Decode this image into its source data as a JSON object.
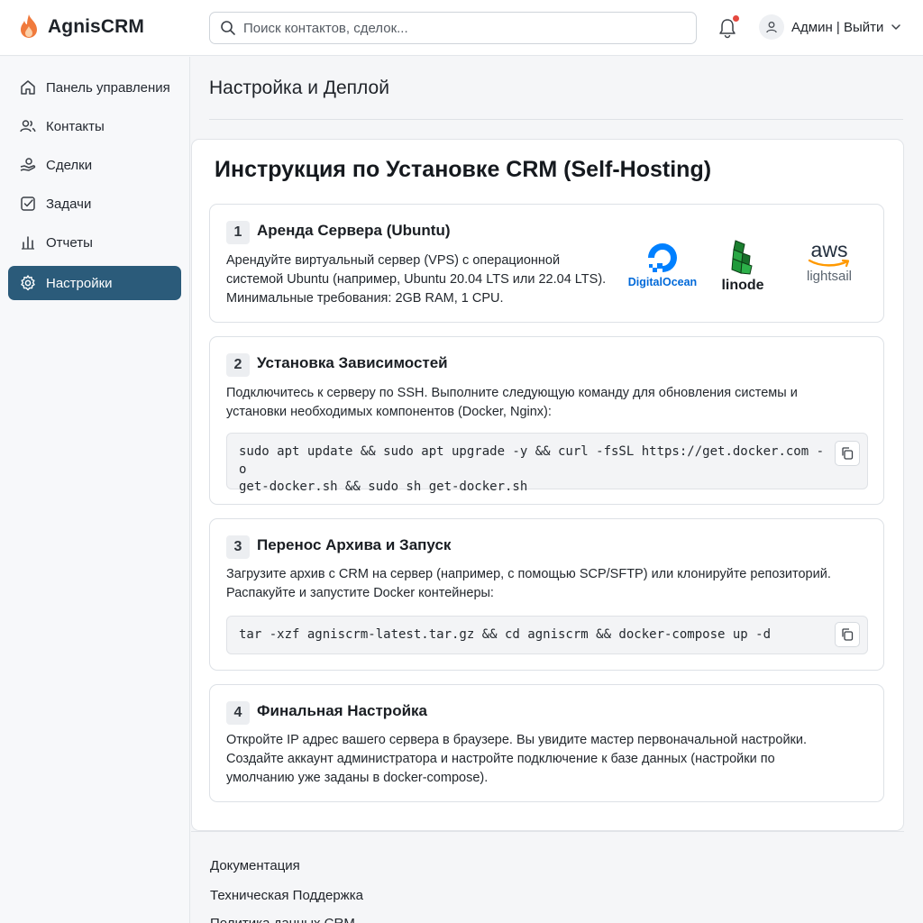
{
  "app": {
    "name": "AgnisCRM"
  },
  "search": {
    "placeholder": "Поиск контактов, сделок..."
  },
  "user": {
    "label": "Админ | Выйти"
  },
  "sidebar": {
    "items": [
      {
        "label": "Панель управления",
        "icon": "home-icon"
      },
      {
        "label": "Контакты",
        "icon": "users-icon"
      },
      {
        "label": "Сделки",
        "icon": "handshake-icon"
      },
      {
        "label": "Задачи",
        "icon": "checkbox-icon"
      },
      {
        "label": "Отчеты",
        "icon": "bar-chart-icon"
      },
      {
        "label": "Настройки",
        "icon": "gear-icon",
        "active": true
      }
    ]
  },
  "main": {
    "title": "Настройка и Деплой",
    "panel_title": "Инструкция по Установке CRM (Self-Hosting)",
    "steps": [
      {
        "number": "1",
        "title": "Аренда Сервера (Ubuntu)",
        "lines": [
          "Арендуйте виртуальный сервер (VPS) с операционной",
          "системой Ubuntu (например, Ubuntu 20.04 LTS или 22.04 LTS).",
          "Минимальные требования: 2GB RAM, 1 CPU."
        ],
        "providers": [
          "DigitalOcean",
          "linode",
          "aws",
          "lightsail"
        ]
      },
      {
        "number": "2",
        "title": "Установка Зависимостей",
        "lines": [
          "Подключитесь к серверу по SSH. Выполните следующую команду для обновления системы и",
          "установки необходимых компонентов (Docker, Nginx):"
        ],
        "code_lines": [
          "sudo apt update && sudo apt upgrade -y && curl -fsSL https://get.docker.com -o",
          "get-docker.sh && sudo sh get-docker.sh"
        ]
      },
      {
        "number": "3",
        "title": "Перенос Архива и Запуск",
        "lines": [
          "Загрузите архив с CRM на сервер (например, с помощью SCP/SFTP) или клонируйте репозиторий.",
          "Распакуйте и запустите Docker контейнеры:"
        ],
        "code_lines": [
          "tar -xzf agniscrm-latest.tar.gz && cd agniscrm && docker-compose up -d"
        ]
      },
      {
        "number": "4",
        "title": "Финальная Настройка",
        "lines": [
          "Откройте IP адрес вашего сервера в браузере. Вы увидите мастер первоначальной настройки.",
          "Создайте аккаунт администратора и настройте подключение к базе данных (настройки по",
          "умолчанию уже заданы в docker-compose)."
        ]
      }
    ]
  },
  "footer": {
    "links": [
      "Документация",
      "Техническая Поддержка",
      "Политика данных CRM"
    ]
  },
  "colors": {
    "accent": "#2b5b7a",
    "notification": "#e5483f",
    "brand_flame": "#f07a3c",
    "digitalocean": "#0080ff",
    "linode": "#1f9a3b",
    "aws_smile": "#ff9900"
  }
}
